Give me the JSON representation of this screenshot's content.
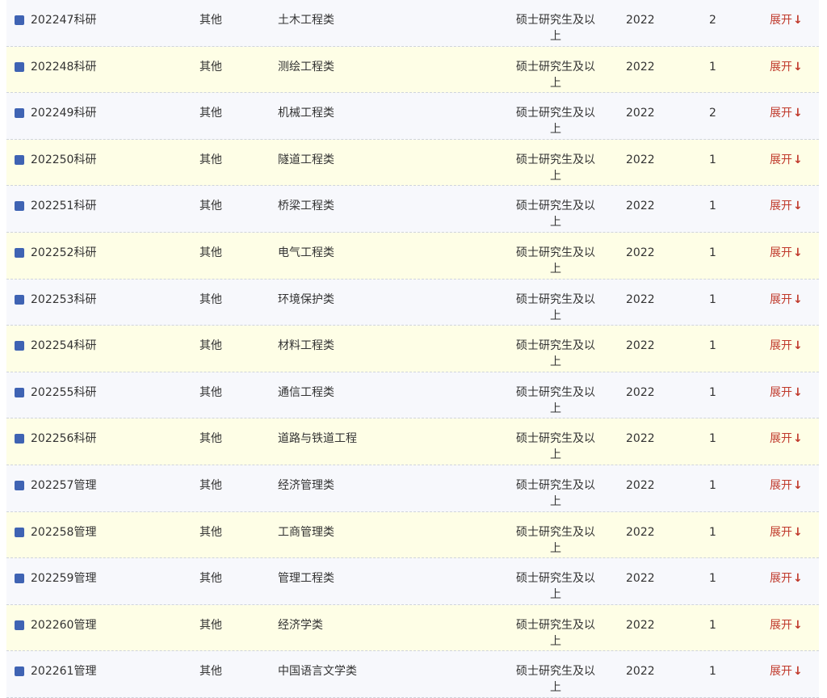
{
  "table": {
    "expand_label": "展开",
    "expand_icon": "↓",
    "colors": {
      "odd_row": "#f7f8fc",
      "even_row": "#fefee6",
      "checkbox": "#3f63b3",
      "expand": "#c0392b"
    },
    "rows": [
      {
        "code": "202247科研",
        "type": "其他",
        "major": "土木工程类",
        "education": "硕士研究生及以上",
        "year": "2022",
        "count": "2"
      },
      {
        "code": "202248科研",
        "type": "其他",
        "major": "测绘工程类",
        "education": "硕士研究生及以上",
        "year": "2022",
        "count": "1"
      },
      {
        "code": "202249科研",
        "type": "其他",
        "major": "机械工程类",
        "education": "硕士研究生及以上",
        "year": "2022",
        "count": "2"
      },
      {
        "code": "202250科研",
        "type": "其他",
        "major": "隧道工程类",
        "education": "硕士研究生及以上",
        "year": "2022",
        "count": "1"
      },
      {
        "code": "202251科研",
        "type": "其他",
        "major": "桥梁工程类",
        "education": "硕士研究生及以上",
        "year": "2022",
        "count": "1"
      },
      {
        "code": "202252科研",
        "type": "其他",
        "major": "电气工程类",
        "education": "硕士研究生及以上",
        "year": "2022",
        "count": "1"
      },
      {
        "code": "202253科研",
        "type": "其他",
        "major": "环境保护类",
        "education": "硕士研究生及以上",
        "year": "2022",
        "count": "1"
      },
      {
        "code": "202254科研",
        "type": "其他",
        "major": "材料工程类",
        "education": "硕士研究生及以上",
        "year": "2022",
        "count": "1"
      },
      {
        "code": "202255科研",
        "type": "其他",
        "major": "通信工程类",
        "education": "硕士研究生及以上",
        "year": "2022",
        "count": "1"
      },
      {
        "code": "202256科研",
        "type": "其他",
        "major": "道路与铁道工程",
        "education": "硕士研究生及以上",
        "year": "2022",
        "count": "1"
      },
      {
        "code": "202257管理",
        "type": "其他",
        "major": "经济管理类",
        "education": "硕士研究生及以上",
        "year": "2022",
        "count": "1"
      },
      {
        "code": "202258管理",
        "type": "其他",
        "major": "工商管理类",
        "education": "硕士研究生及以上",
        "year": "2022",
        "count": "1"
      },
      {
        "code": "202259管理",
        "type": "其他",
        "major": "管理工程类",
        "education": "硕士研究生及以上",
        "year": "2022",
        "count": "1"
      },
      {
        "code": "202260管理",
        "type": "其他",
        "major": "经济学类",
        "education": "硕士研究生及以上",
        "year": "2022",
        "count": "1"
      },
      {
        "code": "202261管理",
        "type": "其他",
        "major": "中国语言文学类",
        "education": "硕士研究生及以上",
        "year": "2022",
        "count": "1"
      }
    ]
  }
}
